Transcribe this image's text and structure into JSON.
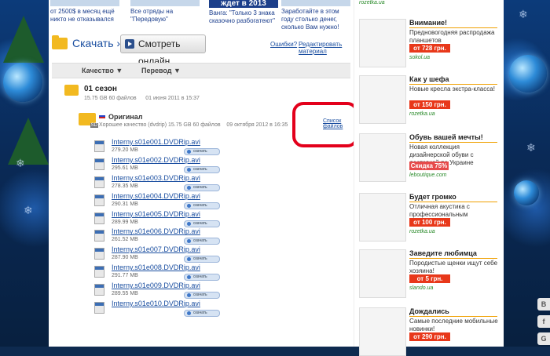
{
  "promo": [
    {
      "text": "от 2500$ в месяц ещё никто не отказывался"
    },
    {
      "text": "Все отряды на \"Передовую\""
    },
    {
      "text": "Ванга: \"Только 3 знака сказочно разбогатеют\""
    },
    {
      "text": "Заработайте в этом году",
      "subtext": "столько денег, сколько Вам нужно!"
    }
  ],
  "banner_text": "ждет в 2013",
  "actions": {
    "download_label": "Скачать",
    "watch_label": "Смотреть онлайн",
    "errors_link": "Ошибки?",
    "edit_link": "Редактировать материал"
  },
  "sort": {
    "quality": "Качество",
    "translation": "Перевод"
  },
  "season": {
    "title": "01 сезон",
    "size": "15.75 GB 60 файлов",
    "date": "01 июня 2011 в 15:37"
  },
  "translation": {
    "title": "Оригинал",
    "meta": "Хорошее качество (dvdrip) 15.75 GB 60 файлов",
    "date": "09 октября 2012 в 16:35",
    "files_link": "Список файлов"
  },
  "download_btn": "скачать",
  "files": [
    {
      "name": "Interny.s01e001.DVDRip.avi",
      "size": "279.20 MB"
    },
    {
      "name": "Interny.s01e002.DVDRip.avi",
      "size": "295.61 MB"
    },
    {
      "name": "Interny.s01e003.DVDRip.avi",
      "size": "278.35 MB"
    },
    {
      "name": "Interny.s01e004.DVDRip.avi",
      "size": "290.31 MB"
    },
    {
      "name": "Interny.s01e005.DVDRip.avi",
      "size": "289.99 MB"
    },
    {
      "name": "Interny.s01e006.DVDRip.avi",
      "size": "261.52 MB"
    },
    {
      "name": "Interny.s01e007.DVDRip.avi",
      "size": "287.90 MB"
    },
    {
      "name": "Interny.s01e008.DVDRip.avi",
      "size": "291.77 MB"
    },
    {
      "name": "Interny.s01e009.DVDRip.avi",
      "size": "289.55 MB"
    },
    {
      "name": "Interny.s01e010.DVDRip.avi",
      "size": ""
    }
  ],
  "ads": {
    "top_source": "rozetka.ua",
    "items": [
      {
        "title": "Внимание!",
        "desc": "Предновогодняя распродажа планшетов",
        "price": "от 728 грн.",
        "source": "sokol.ua"
      },
      {
        "title": "Как у шефа",
        "desc": "Новые кресла экстра-класса!",
        "price": "от 150 грн.",
        "source": "rozetka.ua"
      },
      {
        "title": "Обувь вашей мечты!",
        "desc": "Новая коллекция дизайнерской обуви с доставкой по Украине",
        "price": "Скидка 75%",
        "source": "leboutique.com"
      },
      {
        "title": "Будет громко",
        "desc": "Отличная акустика с профессиональным звучанием!",
        "price": "от 100 грн.",
        "source": "rozetka.ua"
      },
      {
        "title": "Заведите любимца",
        "desc": "Породистые щенки ищут себе хозяина!",
        "price": "от 5 грн.",
        "source": "slando.ua"
      },
      {
        "title": "Дождались",
        "desc": "Самые последние мобильные новинки!",
        "price": "от 290 грн.",
        "source": ""
      }
    ]
  },
  "side_tabs": [
    "B",
    "f",
    "G"
  ]
}
